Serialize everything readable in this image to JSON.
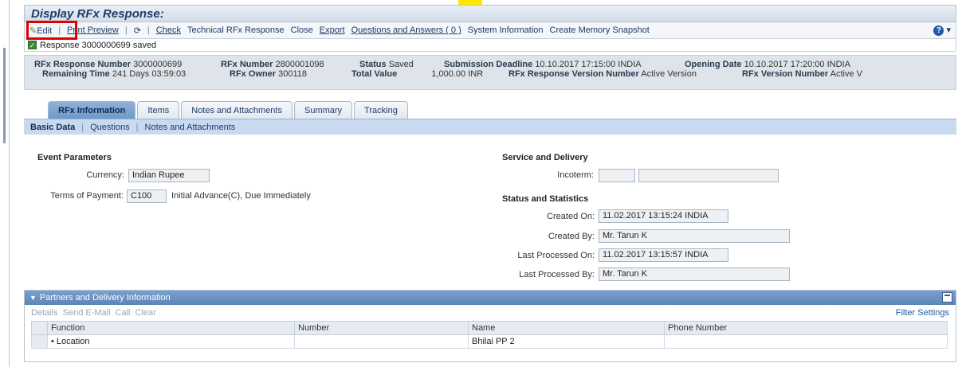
{
  "app": {
    "title": "Display RFx Response:"
  },
  "toolbar": {
    "edit": "Edit",
    "print_preview": "Print Preview",
    "check": "Check",
    "technical": "Technical RFx Response",
    "close": "Close",
    "export": "Export",
    "qa": "Questions and Answers ( 0 )",
    "sysinfo": "System Information",
    "snapshot": "Create Memory Snapshot"
  },
  "message": {
    "text": "Response 3000000699 saved"
  },
  "header": {
    "resp_num_label": "RFx Response Number",
    "resp_num": "3000000699",
    "remaining_label": "Remaining Time",
    "remaining": "241 Days 03:59:03",
    "rfx_num_label": "RFx Number",
    "rfx_num": "2800001098",
    "owner_label": "RFx Owner",
    "owner": "300118",
    "status_label": "Status",
    "status": "Saved",
    "total_label": "Total Value",
    "total": "1,000.00 INR",
    "deadline_label": "Submission Deadline",
    "deadline": "10.10.2017 17:15:00 INDIA",
    "resp_ver_label": "RFx Response Version Number",
    "resp_ver": "Active Version",
    "opening_label": "Opening Date",
    "opening": "10.10.2017 17:20:00 INDIA",
    "rfx_ver_label": "RFx Version Number",
    "rfx_ver": "Active V"
  },
  "tabs": [
    "RFx Information",
    "Items",
    "Notes and Attachments",
    "Summary",
    "Tracking"
  ],
  "subtabs": [
    "Basic Data",
    "Questions",
    "Notes and Attachments"
  ],
  "event": {
    "title": "Event Parameters",
    "currency_label": "Currency:",
    "currency": "Indian Rupee",
    "terms_label": "Terms of Payment:",
    "terms_code": "C100",
    "terms_text": "Initial Advance(C), Due Immediately"
  },
  "service": {
    "title": "Service and Delivery",
    "incoterm_label": "Incoterm:"
  },
  "stats": {
    "title": "Status and Statistics",
    "created_on_label": "Created On:",
    "created_on": "11.02.2017 13:15:24 INDIA",
    "created_by_label": "Created By:",
    "created_by": "Mr. Tarun K",
    "last_on_label": "Last Processed On:",
    "last_on": "11.02.2017 13:15:57 INDIA",
    "last_by_label": "Last Processed By:",
    "last_by": "Mr. Tarun K"
  },
  "partners": {
    "title": "Partners and Delivery Information",
    "tools": [
      "Details",
      "Send E-Mail",
      "Call",
      "Clear"
    ],
    "filter": "Filter Settings",
    "columns": [
      "Function",
      "Number",
      "Name",
      "Phone Number"
    ],
    "rows": [
      {
        "function": "• Location",
        "number": "",
        "name": "Bhilai PP 2",
        "phone": ""
      }
    ]
  }
}
